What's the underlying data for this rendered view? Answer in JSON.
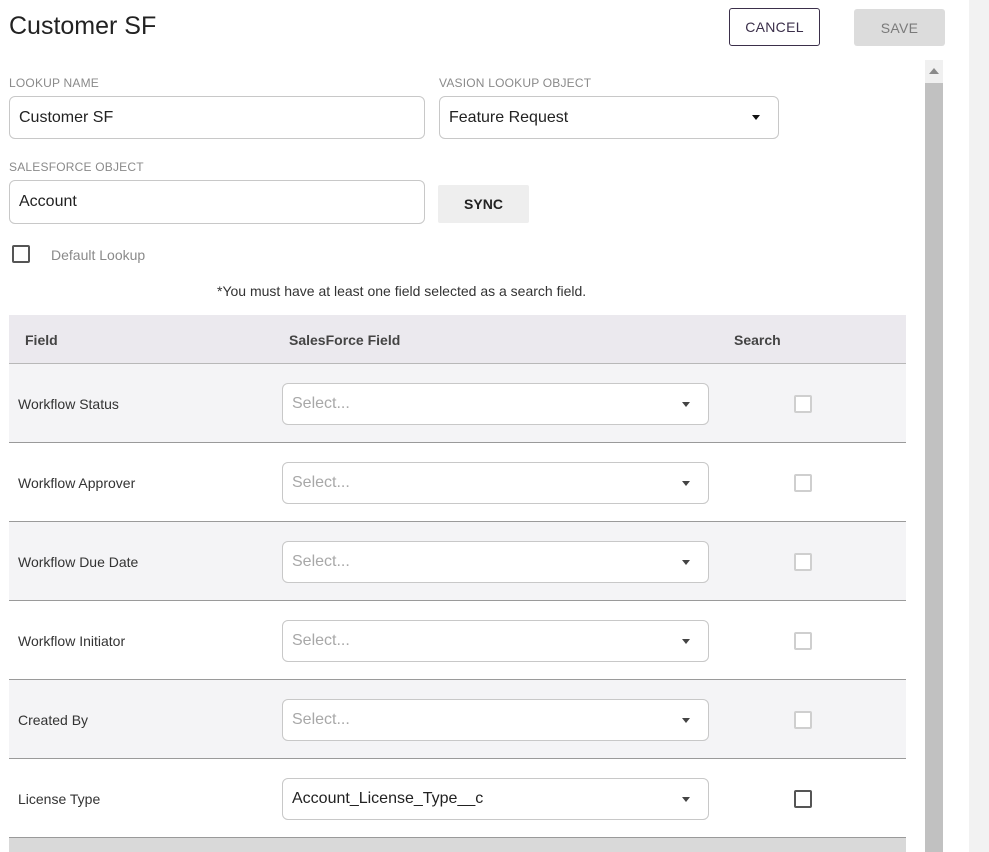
{
  "header": {
    "title": "Customer SF",
    "cancel_label": "CANCEL",
    "save_label": "SAVE"
  },
  "form": {
    "lookup_name": {
      "label": "LOOKUP NAME",
      "value": "Customer SF"
    },
    "vasion_lookup_object": {
      "label": "VASION LOOKUP OBJECT",
      "value": "Feature Request"
    },
    "salesforce_object": {
      "label": "SALESFORCE OBJECT",
      "value": "Account"
    },
    "sync_label": "SYNC",
    "default_lookup": {
      "label": "Default Lookup",
      "checked": false
    }
  },
  "note": "*You must have at least one field selected as a search field.",
  "table": {
    "headers": {
      "field": "Field",
      "salesforce_field": "SalesForce Field",
      "search": "Search"
    },
    "rows": [
      {
        "field": "Workflow Status",
        "salesforce_field": "Select...",
        "is_placeholder": true,
        "search_enabled": false
      },
      {
        "field": "Workflow Approver",
        "salesforce_field": "Select...",
        "is_placeholder": true,
        "search_enabled": false
      },
      {
        "field": "Workflow Due Date",
        "salesforce_field": "Select...",
        "is_placeholder": true,
        "search_enabled": false
      },
      {
        "field": "Workflow Initiator",
        "salesforce_field": "Select...",
        "is_placeholder": true,
        "search_enabled": false
      },
      {
        "field": "Created By",
        "salesforce_field": "Select...",
        "is_placeholder": true,
        "search_enabled": false
      },
      {
        "field": "License Type",
        "salesforce_field": "Account_License_Type__c",
        "is_placeholder": false,
        "search_enabled": true
      }
    ]
  },
  "icons": {
    "dropdown": "caret-down-icon",
    "scroll_up": "scroll-up-arrow-icon"
  },
  "colors": {
    "cancel_border": "#3b2f4a",
    "save_bg": "#dcdcdc",
    "table_header_bg": "#ebe9ee"
  }
}
